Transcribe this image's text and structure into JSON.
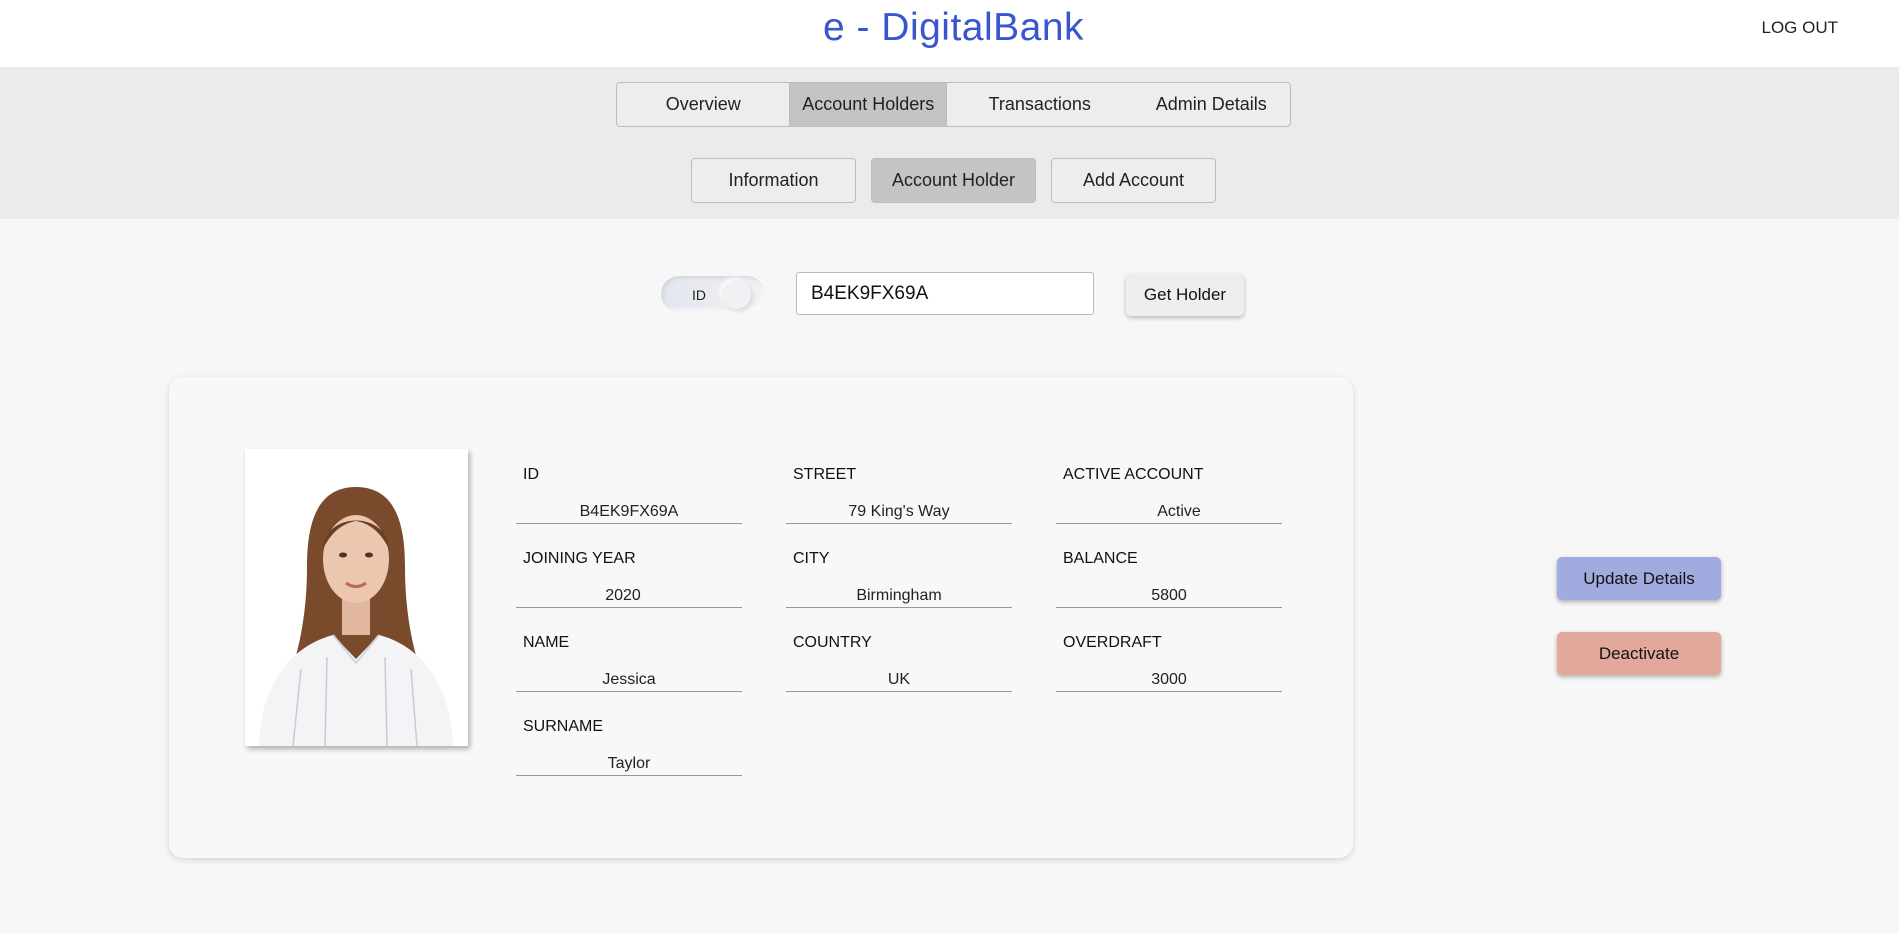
{
  "header": {
    "brand": "e - DigitalBank",
    "logout": "LOG OUT"
  },
  "nav": {
    "tabs": [
      {
        "label": "Overview"
      },
      {
        "label": "Account Holders",
        "active": true
      },
      {
        "label": "Transactions"
      },
      {
        "label": "Admin Details"
      }
    ],
    "subtabs": [
      {
        "label": "Information"
      },
      {
        "label": "Account Holder",
        "active": true
      },
      {
        "label": "Add Account"
      }
    ]
  },
  "search": {
    "toggle_label": "ID",
    "value": "B4EK9FX69A",
    "button": "Get Holder"
  },
  "holder": {
    "photo_icon": "person-portrait",
    "fields": [
      {
        "label": "ID",
        "value": "B4EK9FX69A"
      },
      {
        "label": "JOINING YEAR",
        "value": "2020"
      },
      {
        "label": "NAME",
        "value": "Jessica"
      },
      {
        "label": "SURNAME",
        "value": "Taylor"
      },
      {
        "label": "STREET",
        "value": "79 King's Way"
      },
      {
        "label": "CITY",
        "value": "Birmingham"
      },
      {
        "label": "COUNTRY",
        "value": "UK"
      },
      {
        "label": "ACTIVE ACCOUNT",
        "value": "Active"
      },
      {
        "label": "BALANCE",
        "value": "5800"
      },
      {
        "label": "OVERDRAFT",
        "value": "3000"
      }
    ]
  },
  "actions": {
    "update": "Update Details",
    "deactivate": "Deactivate"
  },
  "colors": {
    "brand": "#3a56cf",
    "update": "#a2abdf",
    "deactivate": "#e3a89c",
    "active_tab": "#c4c3c6"
  }
}
